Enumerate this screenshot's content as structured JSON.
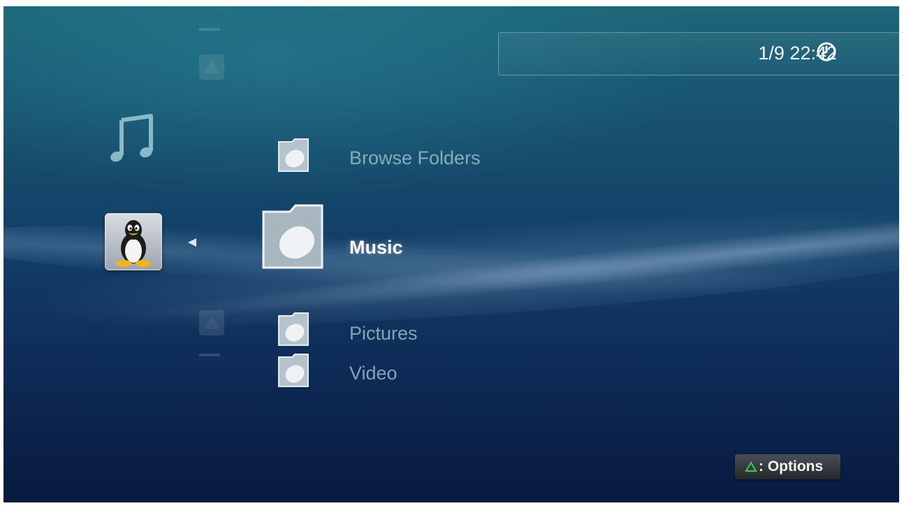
{
  "status": {
    "datetime": "1/9 22:42",
    "clock_icon": "clock-icon"
  },
  "xmb": {
    "category_icons": [
      "music-note-icon",
      "linux-penguin-icon"
    ],
    "items": [
      {
        "label": "Browse Folders",
        "icon": "folder-icon",
        "state": "dim"
      },
      {
        "label": "Music",
        "icon": "folder-icon",
        "state": "selected"
      },
      {
        "label": "Pictures",
        "icon": "folder-icon",
        "state": "dim"
      },
      {
        "label": "Video",
        "icon": "folder-icon",
        "state": "dim"
      }
    ]
  },
  "footer": {
    "options_label": ": Options",
    "options_icon": "triangle-button-icon"
  },
  "colors": {
    "accent": "#2e8f3a",
    "text_selected": "#ffffff",
    "text_dim": "#afc8d7"
  }
}
